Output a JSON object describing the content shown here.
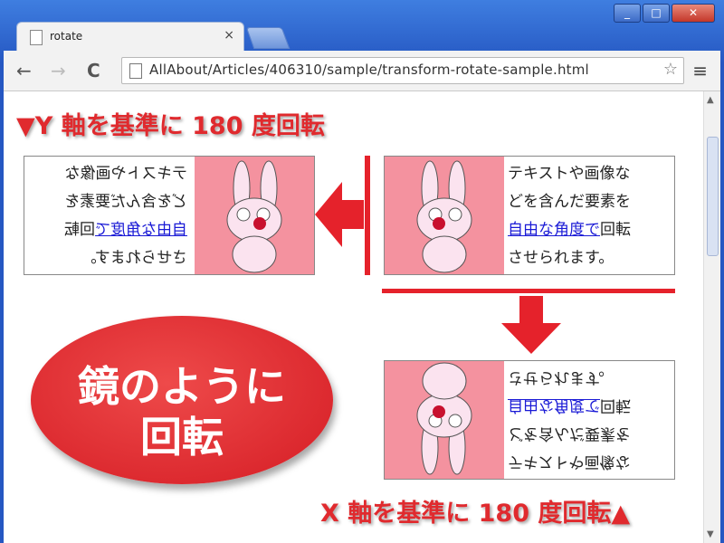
{
  "window": {
    "minimize": "_",
    "maximize": "□",
    "close": "✕"
  },
  "tab": {
    "title": "rotate",
    "close": "×"
  },
  "toolbar": {
    "back": "←",
    "forward": "→",
    "reload": "C",
    "url": "AllAbout/Articles/406310/sample/transform-rotate-sample.html",
    "menu": "≡"
  },
  "headings": {
    "y_axis": "▼Y 軸を基準に 180 度回転",
    "x_axis": "X 軸を基準に 180 度回転▲"
  },
  "sample": {
    "line1": "テキストや画像な",
    "line2": "どを含んだ要素を",
    "link": "自由な角度で",
    "line3_rest": "回転",
    "line4": "させられます。"
  },
  "callout": {
    "line1": "鏡のように",
    "line2": "回転"
  },
  "colors": {
    "accent": "#e5222b",
    "image_bg": "#f4929f",
    "link": "#1a1ad6"
  }
}
